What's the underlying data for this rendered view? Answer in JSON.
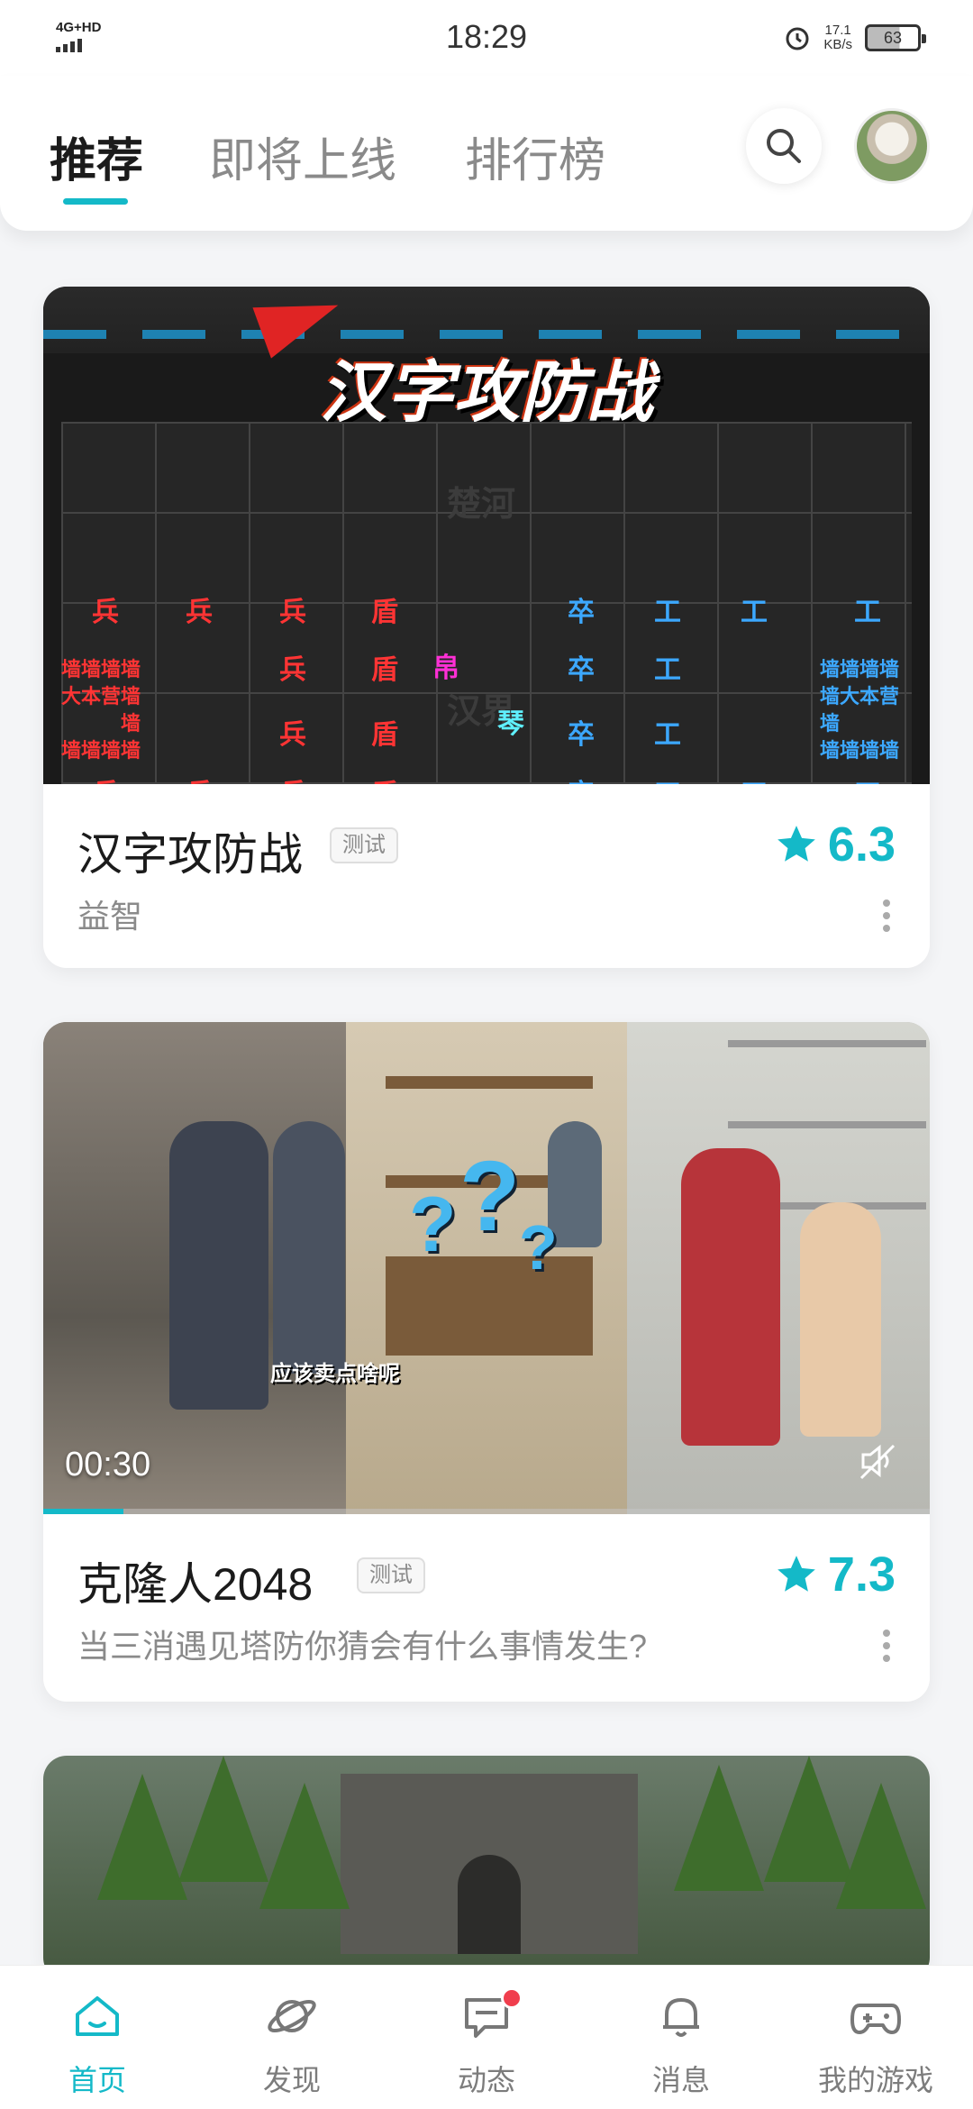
{
  "status_bar": {
    "network": "4G+HD",
    "time": "18:29",
    "speed_value": "17.1",
    "speed_unit": "KB/s",
    "battery": "63"
  },
  "header": {
    "tabs": [
      "推荐",
      "即将上线",
      "排行榜"
    ],
    "active_tab": "推荐",
    "search_icon": "search-icon",
    "accent_color": "#14b9c8"
  },
  "cards": [
    {
      "title": "汉字攻防战",
      "badge": "测试",
      "rating": "6.3",
      "subtitle": "益智",
      "art": {
        "title": "汉字攻防战",
        "river_top": "楚河",
        "river_bottom": "汉界",
        "red_pieces": [
          "兵",
          "兵",
          "兵",
          "盾",
          "兵",
          "盾",
          "兵",
          "盾",
          "兵",
          "兵",
          "兵",
          "盾"
        ],
        "blue_pieces": [
          "卒",
          "工",
          "工",
          "工",
          "卒",
          "工",
          "卒",
          "工",
          "卒",
          "工",
          "工",
          "工"
        ],
        "mid_pieces": [
          "帛",
          "琴"
        ],
        "red_wall": [
          "墙墙墙墙",
          "大本营墙",
          "墙",
          "墙墙墙墙"
        ],
        "blue_wall": [
          "墙墙墙墙",
          "墙大本营",
          "墙",
          "墙墙墙墙"
        ]
      }
    },
    {
      "title": "克隆人2048",
      "badge": "测试",
      "rating": "7.3",
      "subtitle": "当三消遇见塔防你猜会有什么事情发生?",
      "video": {
        "time": "00:30",
        "caption": "应该卖点啥呢",
        "progress": 0.09
      }
    },
    {
      "title": "",
      "media_only": true
    }
  ],
  "bottom_nav": [
    {
      "label": "首页",
      "icon": "home-icon",
      "active": true
    },
    {
      "label": "发现",
      "icon": "planet-icon",
      "active": false
    },
    {
      "label": "动态",
      "icon": "chat-icon",
      "active": false,
      "has_dot": true
    },
    {
      "label": "消息",
      "icon": "bell-icon",
      "active": false
    },
    {
      "label": "我的游戏",
      "icon": "gamepad-icon",
      "active": false
    }
  ]
}
